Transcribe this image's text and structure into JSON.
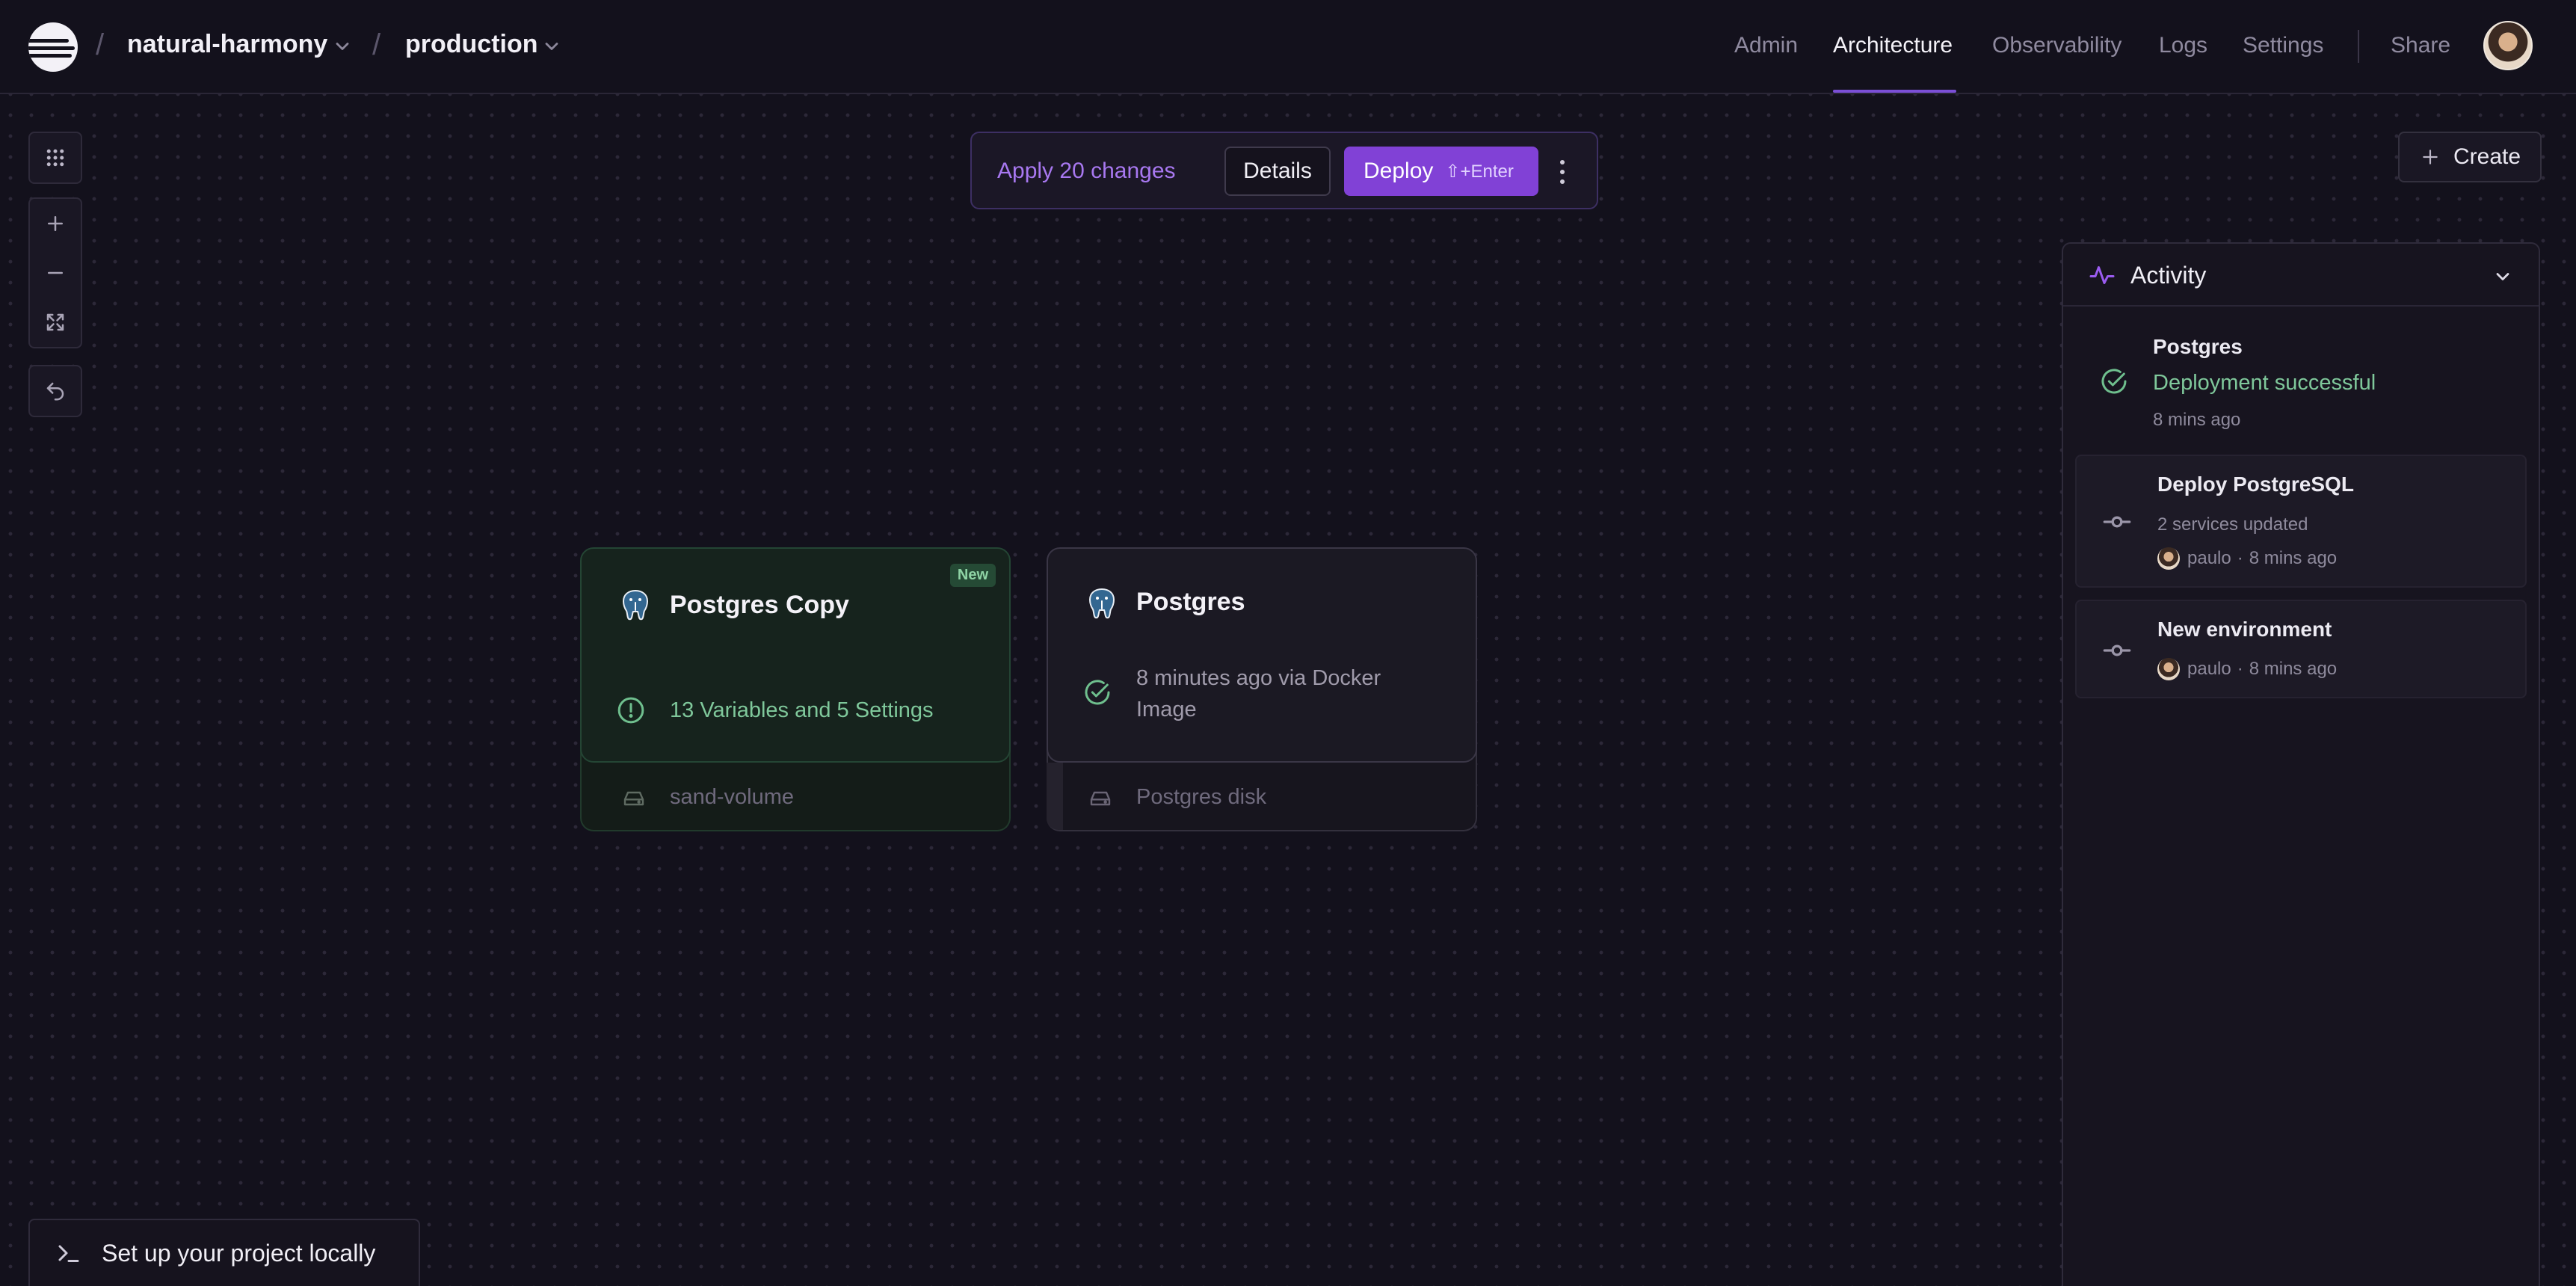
{
  "header": {
    "project": "natural-harmony",
    "environment": "production",
    "separator": "/",
    "nav": [
      "Admin",
      "Architecture",
      "Observability",
      "Logs",
      "Settings"
    ],
    "active_nav": "Architecture",
    "share": "Share"
  },
  "apply_bar": {
    "text": "Apply 20 changes",
    "details": "Details",
    "deploy": "Deploy",
    "deploy_hint": "⇧+Enter"
  },
  "create": {
    "label": "Create"
  },
  "cards": [
    {
      "title": "Postgres Copy",
      "badge": "New",
      "status_line1": "13 Variables and 5 Settings",
      "status_line2": "",
      "volume": "sand-volume"
    },
    {
      "title": "Postgres",
      "badge": "",
      "status_line1": "8 minutes ago via Docker",
      "status_line2": "Image",
      "volume": "Postgres disk"
    }
  ],
  "activity": {
    "title": "Activity",
    "items": [
      {
        "title": "Postgres",
        "subtitle": "Deployment successful",
        "meta": "8 mins ago"
      },
      {
        "title": "Deploy PostgreSQL",
        "subtitle": "2 services updated",
        "user": "paulo",
        "time": "8 mins ago",
        "sep": "·"
      },
      {
        "title": "New environment",
        "user": "paulo",
        "time": "8 mins ago",
        "sep": "·"
      }
    ]
  },
  "setup": {
    "label": "Set up your project locally"
  },
  "colors": {
    "accent": "#8141d6",
    "success": "#6fbf8e",
    "background": "#13111c"
  }
}
